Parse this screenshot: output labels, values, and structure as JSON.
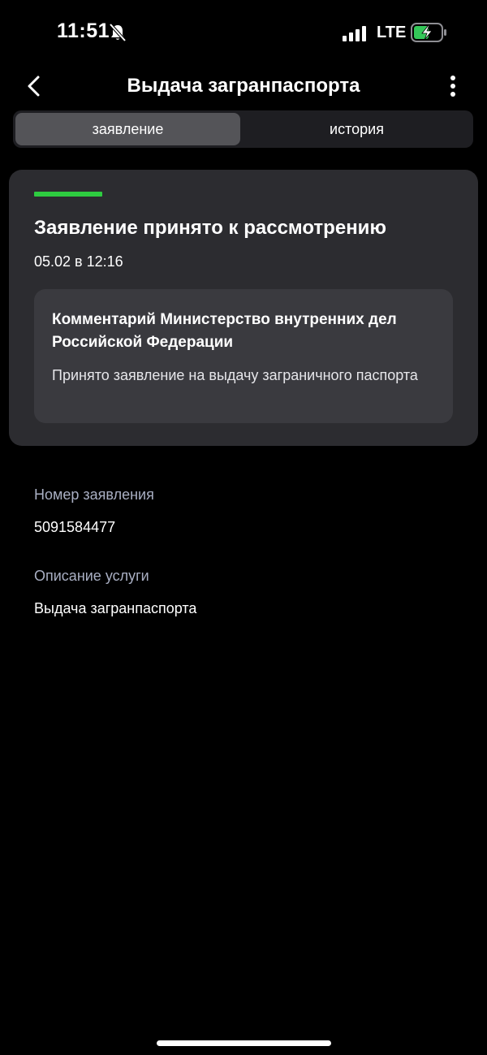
{
  "status_bar": {
    "time": "11:51",
    "network": "LTE",
    "battery_color": "#34c759"
  },
  "header": {
    "title": "Выдача загранпаспорта"
  },
  "tabs": [
    {
      "label": "заявление",
      "active": true
    },
    {
      "label": "история",
      "active": false
    }
  ],
  "status_card": {
    "accent_color": "#2ecc40",
    "title": "Заявление принято к рассмотрению",
    "date": "05.02 в 12:16",
    "comment": {
      "title": "Комментарий Министерство внутренних дел Российской Федерации",
      "text": "Принято заявление на выдачу заграничного паспорта"
    }
  },
  "fields": {
    "application_number": {
      "label": "Номер заявления",
      "value": "5091584477"
    },
    "service_description": {
      "label": "Описание услуги",
      "value": "Выдача загранпаспорта"
    }
  }
}
